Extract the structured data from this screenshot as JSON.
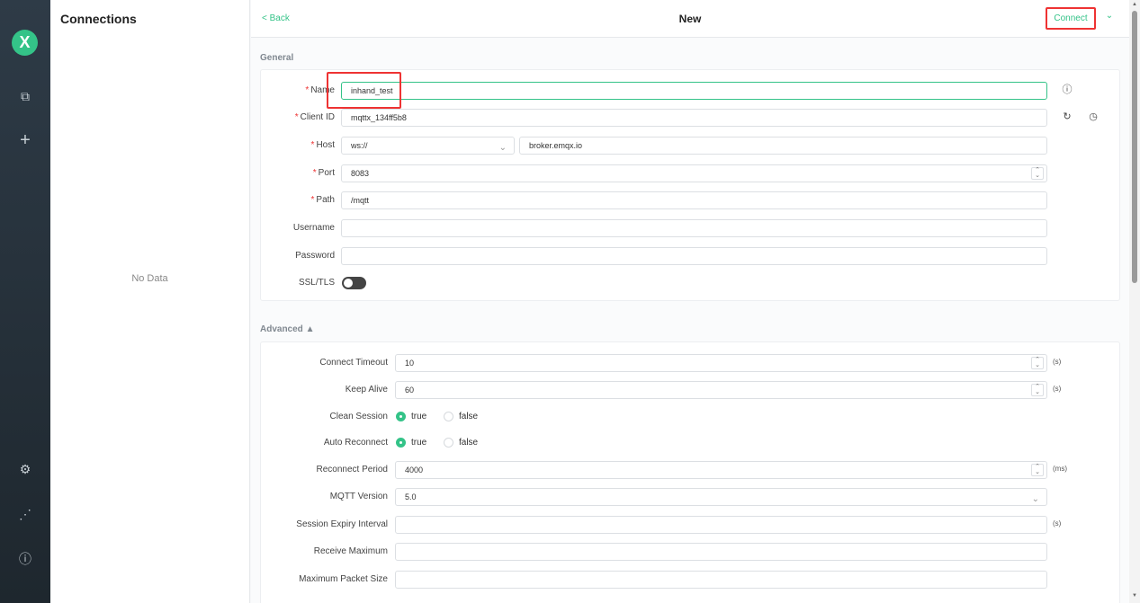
{
  "nav": {
    "logo_glyph": "X",
    "items": [
      {
        "name": "connections-icon",
        "glyph": "⧉"
      },
      {
        "name": "plus-icon",
        "glyph": "+"
      },
      {
        "name": "settings-icon",
        "glyph": "⚙"
      },
      {
        "name": "script-icon",
        "glyph": "⋰"
      },
      {
        "name": "info-icon",
        "glyph": "ⓘ"
      }
    ]
  },
  "connections": {
    "title": "Connections",
    "empty_text": "No Data"
  },
  "topbar": {
    "back_label": "< Back",
    "title": "New",
    "connect_label": "Connect",
    "more_glyph": "⌄"
  },
  "general": {
    "section_title": "General",
    "name": {
      "label": "Name",
      "value": "inhand_test"
    },
    "client_id": {
      "label": "Client ID",
      "value": "mqttx_134ff5b8"
    },
    "host": {
      "label": "Host",
      "protocol": "ws://",
      "value": "broker.emqx.io"
    },
    "port": {
      "label": "Port",
      "value": "8083"
    },
    "path": {
      "label": "Path",
      "value": "/mqtt"
    },
    "username": {
      "label": "Username",
      "value": ""
    },
    "password": {
      "label": "Password",
      "value": ""
    },
    "ssl": {
      "label": "SSL/TLS"
    }
  },
  "advanced": {
    "section_title": "Advanced ▲",
    "connect_timeout": {
      "label": "Connect Timeout",
      "value": "10",
      "unit": "(s)"
    },
    "keep_alive": {
      "label": "Keep Alive",
      "value": "60",
      "unit": "(s)"
    },
    "clean_session": {
      "label": "Clean Session",
      "true_label": "true",
      "false_label": "false"
    },
    "auto_reconnect": {
      "label": "Auto Reconnect",
      "true_label": "true",
      "false_label": "false"
    },
    "reconnect_period": {
      "label": "Reconnect Period",
      "value": "4000",
      "unit": "(ms)"
    },
    "mqtt_version": {
      "label": "MQTT Version",
      "value": "5.0"
    },
    "session_expiry": {
      "label": "Session Expiry Interval",
      "value": "",
      "unit": "(s)"
    },
    "receive_maximum": {
      "label": "Receive Maximum",
      "value": ""
    },
    "max_packet_size": {
      "label": "Maximum Packet Size",
      "value": ""
    }
  },
  "colors": {
    "accent": "#34c388",
    "highlight": "#ee3333"
  }
}
